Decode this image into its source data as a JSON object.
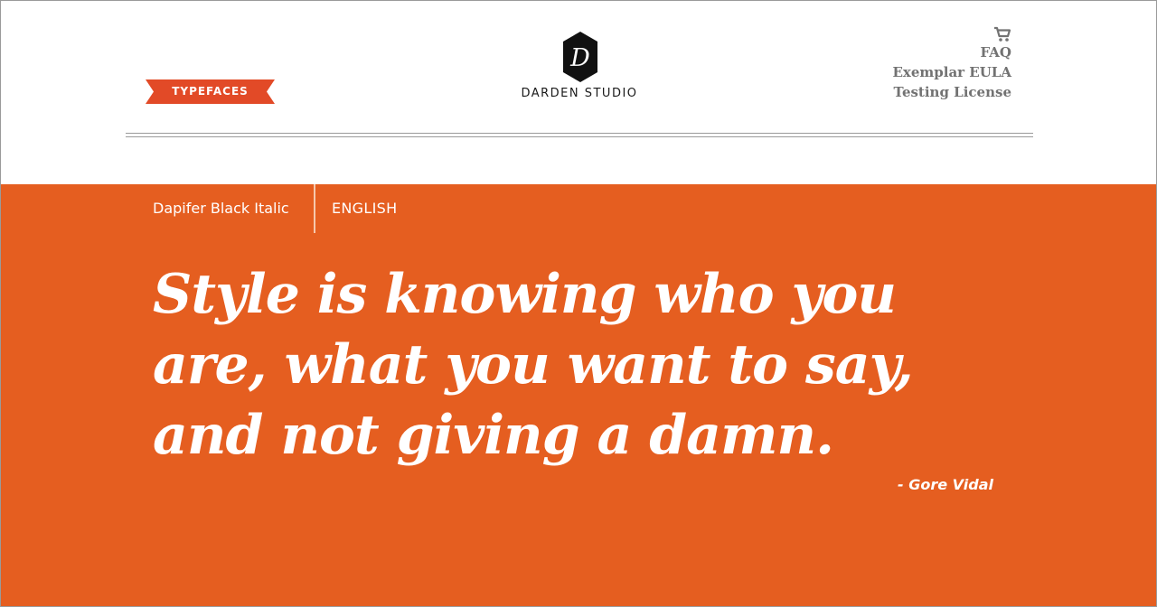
{
  "header": {
    "typefaces_label": "TYPEFACES",
    "brand_name": "DARDEN STUDIO",
    "brand_monogram": "D",
    "nav": {
      "cart_icon": "cart-icon",
      "links": [
        "FAQ",
        "Exemplar EULA",
        "Testing License"
      ]
    }
  },
  "specimen": {
    "font_name": "Dapifer Black Italic",
    "language": "ENGLISH",
    "quote_lines": [
      "Style is knowing who you",
      "are, what you want to say,",
      "and not giving a damn."
    ],
    "attribution": "- Gore Vidal"
  },
  "colors": {
    "accent_orange": "#e55e20",
    "ribbon_red": "#e24a27",
    "nav_gray": "#727272",
    "brand_black": "#1a1a1a"
  }
}
